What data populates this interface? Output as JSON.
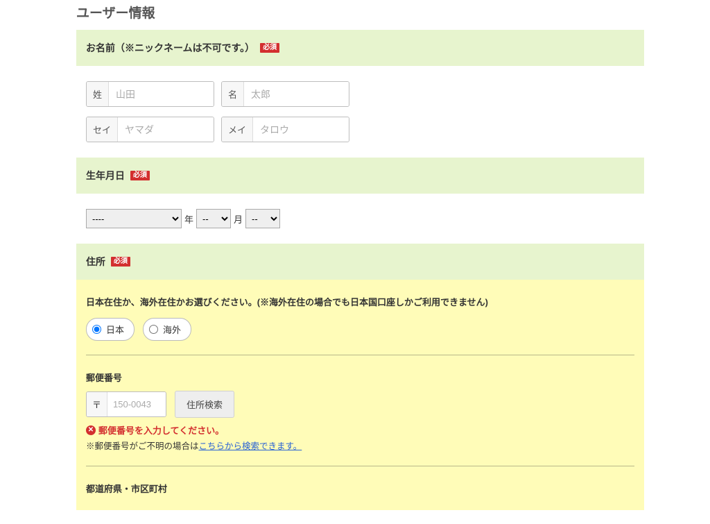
{
  "page_title": "ユーザー情報",
  "required_badge": "必須",
  "name_section": {
    "header": "お名前（※ニックネームは不可です。）",
    "sei": {
      "label": "姓",
      "placeholder": "山田"
    },
    "mei": {
      "label": "名",
      "placeholder": "太郎"
    },
    "sei_kana": {
      "label": "セイ",
      "placeholder": "ヤマダ"
    },
    "mei_kana": {
      "label": "メイ",
      "placeholder": "タロウ"
    }
  },
  "birth_section": {
    "header": "生年月日",
    "year_option": "----",
    "year_unit": "年",
    "month_option": "--",
    "month_unit": "月",
    "day_option": "--"
  },
  "address_section": {
    "header": "住所",
    "instruction": "日本在住か、海外在住かお選びください。(※海外在住の場合でも日本国口座しかご利用できません)",
    "radio_japan": "日本",
    "radio_overseas": "海外",
    "postal_label": "郵便番号",
    "postal_prefix": "〒",
    "postal_placeholder": "150-0043",
    "search_button": "住所検索",
    "error_text": "郵便番号を入力してください。",
    "note_prefix": "※郵便番号がご不明の場合は",
    "note_link": "こちらから検索できます。",
    "pref_city_label": "都道府県・市区町村"
  }
}
